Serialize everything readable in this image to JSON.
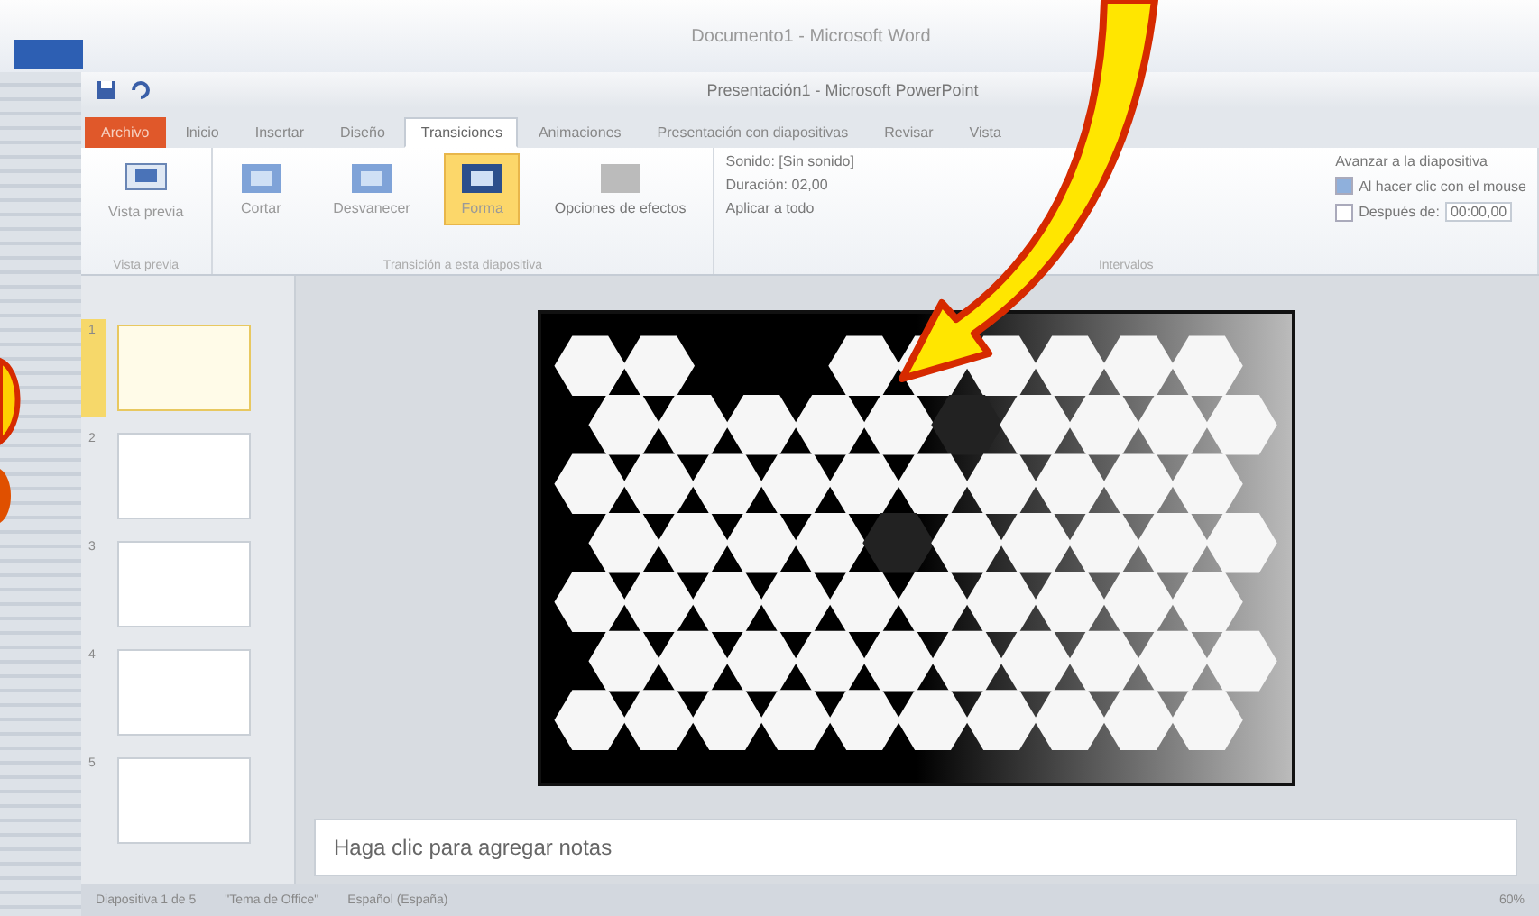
{
  "background_window": {
    "title": "Documento1 - Microsoft Word"
  },
  "window": {
    "title": "Presentación1 - Microsoft PowerPoint"
  },
  "tabs": [
    {
      "label": "Archivo",
      "selected": false,
      "kind": "file"
    },
    {
      "label": "Inicio",
      "selected": false,
      "kind": "tab"
    },
    {
      "label": "Insertar",
      "selected": false,
      "kind": "tab"
    },
    {
      "label": "Diseño",
      "selected": false,
      "kind": "tab"
    },
    {
      "label": "Transiciones",
      "selected": true,
      "kind": "tab"
    },
    {
      "label": "Animaciones",
      "selected": false,
      "kind": "tab"
    },
    {
      "label": "Presentación con diapositivas",
      "selected": false,
      "kind": "tab"
    },
    {
      "label": "Revisar",
      "selected": false,
      "kind": "tab"
    },
    {
      "label": "Vista",
      "selected": false,
      "kind": "tab"
    }
  ],
  "ribbon": {
    "preview": {
      "label": "Vista previa"
    },
    "transitions": [
      {
        "label": "Cortar",
        "selected": false
      },
      {
        "label": "Desvanecer",
        "selected": false
      },
      {
        "label": "Forma",
        "selected": true
      }
    ],
    "effect_options": {
      "label": "Opciones de efectos",
      "disabled": true
    },
    "timing": {
      "sound": "Sonido: [Sin sonido]",
      "duration": "Duración: 02,00",
      "apply_all": "Aplicar a todo",
      "advance_heading": "Avanzar a la diapositiva",
      "on_click": {
        "label": "Al hacer clic con el mouse",
        "checked": true
      },
      "after": {
        "label": "Después de:",
        "checked": false,
        "value": "00:00,00"
      }
    },
    "groups": [
      "Vista previa",
      "Transición a esta diapositiva",
      "Intervalos"
    ]
  },
  "slides": [
    {
      "number": "1",
      "selected": true
    },
    {
      "number": "2",
      "selected": false
    },
    {
      "number": "3",
      "selected": false
    },
    {
      "number": "4",
      "selected": false
    },
    {
      "number": "5",
      "selected": false
    }
  ],
  "notes": {
    "placeholder": "Haga clic para agregar notas"
  },
  "status_bar": {
    "slide": "Diapositiva 1 de 5",
    "theme": "\"Tema de Office\"",
    "language": "Español (España)",
    "zoom": "60%"
  }
}
